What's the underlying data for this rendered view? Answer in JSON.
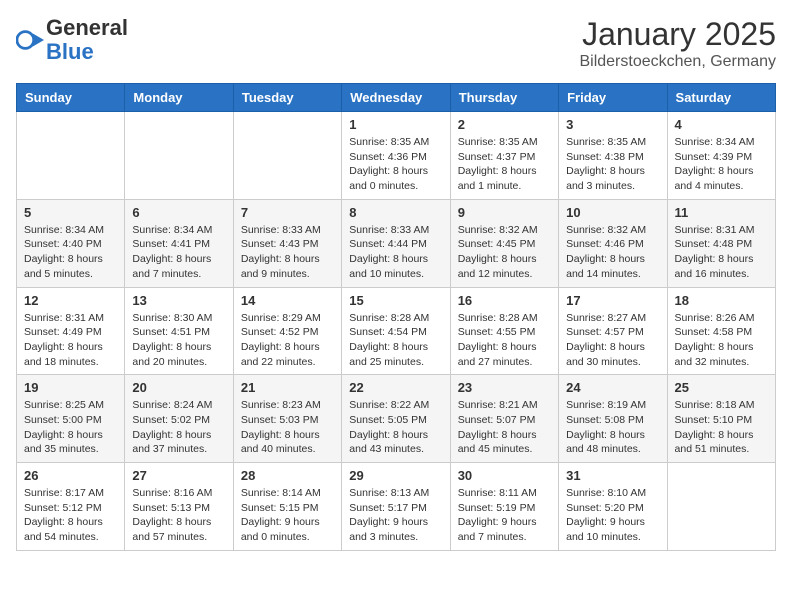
{
  "header": {
    "logo_general": "General",
    "logo_blue": "Blue",
    "title": "January 2025",
    "subtitle": "Bilderstoeckchen, Germany"
  },
  "calendar": {
    "days_of_week": [
      "Sunday",
      "Monday",
      "Tuesday",
      "Wednesday",
      "Thursday",
      "Friday",
      "Saturday"
    ],
    "weeks": [
      [
        {
          "day": "",
          "info": ""
        },
        {
          "day": "",
          "info": ""
        },
        {
          "day": "",
          "info": ""
        },
        {
          "day": "1",
          "info": "Sunrise: 8:35 AM\nSunset: 4:36 PM\nDaylight: 8 hours\nand 0 minutes."
        },
        {
          "day": "2",
          "info": "Sunrise: 8:35 AM\nSunset: 4:37 PM\nDaylight: 8 hours\nand 1 minute."
        },
        {
          "day": "3",
          "info": "Sunrise: 8:35 AM\nSunset: 4:38 PM\nDaylight: 8 hours\nand 3 minutes."
        },
        {
          "day": "4",
          "info": "Sunrise: 8:34 AM\nSunset: 4:39 PM\nDaylight: 8 hours\nand 4 minutes."
        }
      ],
      [
        {
          "day": "5",
          "info": "Sunrise: 8:34 AM\nSunset: 4:40 PM\nDaylight: 8 hours\nand 5 minutes."
        },
        {
          "day": "6",
          "info": "Sunrise: 8:34 AM\nSunset: 4:41 PM\nDaylight: 8 hours\nand 7 minutes."
        },
        {
          "day": "7",
          "info": "Sunrise: 8:33 AM\nSunset: 4:43 PM\nDaylight: 8 hours\nand 9 minutes."
        },
        {
          "day": "8",
          "info": "Sunrise: 8:33 AM\nSunset: 4:44 PM\nDaylight: 8 hours\nand 10 minutes."
        },
        {
          "day": "9",
          "info": "Sunrise: 8:32 AM\nSunset: 4:45 PM\nDaylight: 8 hours\nand 12 minutes."
        },
        {
          "day": "10",
          "info": "Sunrise: 8:32 AM\nSunset: 4:46 PM\nDaylight: 8 hours\nand 14 minutes."
        },
        {
          "day": "11",
          "info": "Sunrise: 8:31 AM\nSunset: 4:48 PM\nDaylight: 8 hours\nand 16 minutes."
        }
      ],
      [
        {
          "day": "12",
          "info": "Sunrise: 8:31 AM\nSunset: 4:49 PM\nDaylight: 8 hours\nand 18 minutes."
        },
        {
          "day": "13",
          "info": "Sunrise: 8:30 AM\nSunset: 4:51 PM\nDaylight: 8 hours\nand 20 minutes."
        },
        {
          "day": "14",
          "info": "Sunrise: 8:29 AM\nSunset: 4:52 PM\nDaylight: 8 hours\nand 22 minutes."
        },
        {
          "day": "15",
          "info": "Sunrise: 8:28 AM\nSunset: 4:54 PM\nDaylight: 8 hours\nand 25 minutes."
        },
        {
          "day": "16",
          "info": "Sunrise: 8:28 AM\nSunset: 4:55 PM\nDaylight: 8 hours\nand 27 minutes."
        },
        {
          "day": "17",
          "info": "Sunrise: 8:27 AM\nSunset: 4:57 PM\nDaylight: 8 hours\nand 30 minutes."
        },
        {
          "day": "18",
          "info": "Sunrise: 8:26 AM\nSunset: 4:58 PM\nDaylight: 8 hours\nand 32 minutes."
        }
      ],
      [
        {
          "day": "19",
          "info": "Sunrise: 8:25 AM\nSunset: 5:00 PM\nDaylight: 8 hours\nand 35 minutes."
        },
        {
          "day": "20",
          "info": "Sunrise: 8:24 AM\nSunset: 5:02 PM\nDaylight: 8 hours\nand 37 minutes."
        },
        {
          "day": "21",
          "info": "Sunrise: 8:23 AM\nSunset: 5:03 PM\nDaylight: 8 hours\nand 40 minutes."
        },
        {
          "day": "22",
          "info": "Sunrise: 8:22 AM\nSunset: 5:05 PM\nDaylight: 8 hours\nand 43 minutes."
        },
        {
          "day": "23",
          "info": "Sunrise: 8:21 AM\nSunset: 5:07 PM\nDaylight: 8 hours\nand 45 minutes."
        },
        {
          "day": "24",
          "info": "Sunrise: 8:19 AM\nSunset: 5:08 PM\nDaylight: 8 hours\nand 48 minutes."
        },
        {
          "day": "25",
          "info": "Sunrise: 8:18 AM\nSunset: 5:10 PM\nDaylight: 8 hours\nand 51 minutes."
        }
      ],
      [
        {
          "day": "26",
          "info": "Sunrise: 8:17 AM\nSunset: 5:12 PM\nDaylight: 8 hours\nand 54 minutes."
        },
        {
          "day": "27",
          "info": "Sunrise: 8:16 AM\nSunset: 5:13 PM\nDaylight: 8 hours\nand 57 minutes."
        },
        {
          "day": "28",
          "info": "Sunrise: 8:14 AM\nSunset: 5:15 PM\nDaylight: 9 hours\nand 0 minutes."
        },
        {
          "day": "29",
          "info": "Sunrise: 8:13 AM\nSunset: 5:17 PM\nDaylight: 9 hours\nand 3 minutes."
        },
        {
          "day": "30",
          "info": "Sunrise: 8:11 AM\nSunset: 5:19 PM\nDaylight: 9 hours\nand 7 minutes."
        },
        {
          "day": "31",
          "info": "Sunrise: 8:10 AM\nSunset: 5:20 PM\nDaylight: 9 hours\nand 10 minutes."
        },
        {
          "day": "",
          "info": ""
        }
      ]
    ]
  }
}
